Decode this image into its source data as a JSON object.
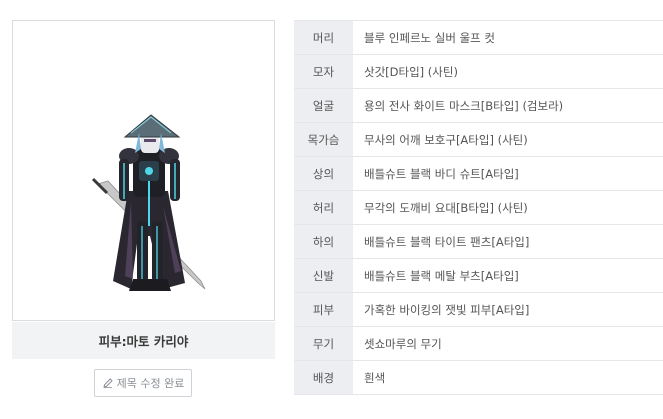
{
  "character": {
    "name": "피부:마토 카리야",
    "edit_title_label": "제목 수정 완료",
    "edit_icon": "pencil-icon"
  },
  "equipment": [
    {
      "slot": "머리",
      "item": "블루 인페르노 실버 울프 컷"
    },
    {
      "slot": "모자",
      "item": "삿갓[D타입] (사틴)"
    },
    {
      "slot": "얼굴",
      "item": "용의 전사 화이트 마스크[B타입] (검보라)"
    },
    {
      "slot": "목가슴",
      "item": "무사의 어깨 보호구[A타입] (사틴)"
    },
    {
      "slot": "상의",
      "item": "배틀슈트 블랙 바디 슈트[A타입]"
    },
    {
      "slot": "허리",
      "item": "무각의 도깨비 요대[B타입] (사틴)"
    },
    {
      "slot": "하의",
      "item": "배틀슈트 블랙 타이트 팬츠[A타입]"
    },
    {
      "slot": "신발",
      "item": "배틀슈트 블랙 메탈 부츠[A타입]"
    },
    {
      "slot": "피부",
      "item": "가혹한 바이킹의 잿빛 피부[A타입]"
    },
    {
      "slot": "무기",
      "item": "셋쇼마루의 무기"
    },
    {
      "slot": "배경",
      "item": "흰색"
    }
  ]
}
